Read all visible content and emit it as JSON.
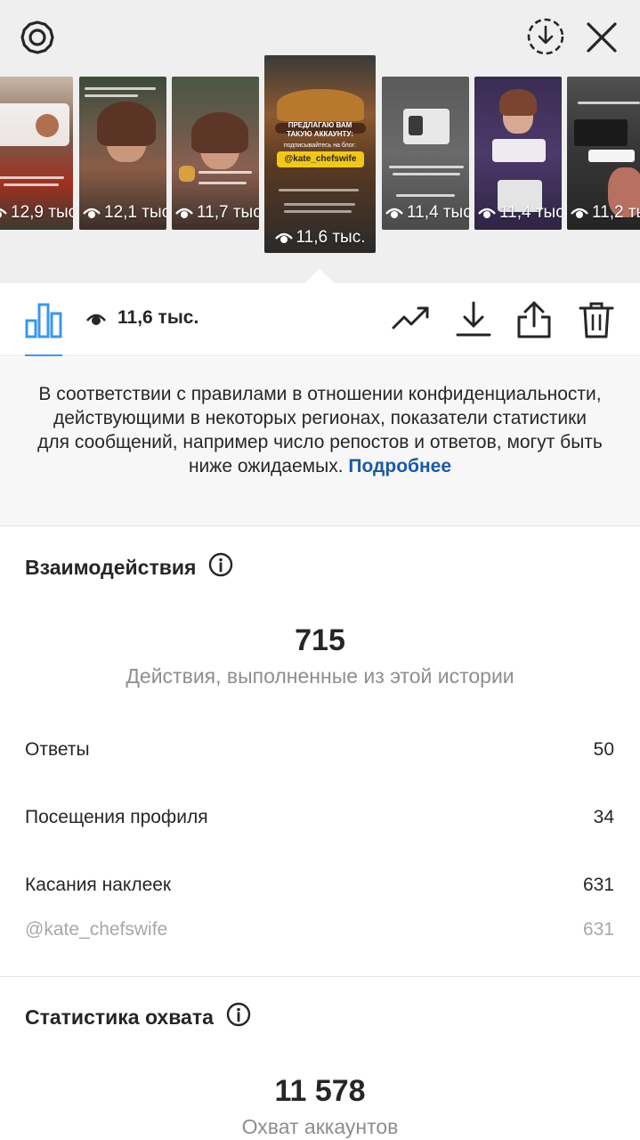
{
  "top": {
    "thumbnails": [
      {
        "views": "12,9 тыс"
      },
      {
        "views": "12,1 тыс"
      },
      {
        "views": "11,7 тыс"
      },
      {
        "views": "11,6 тыс."
      },
      {
        "views": "11,4 тыс"
      },
      {
        "views": "11,4 тыс"
      },
      {
        "views": "11,2 тыс"
      }
    ],
    "selected_story": {
      "headline": "ПРЕДЛАГАЮ ВАМ ТАКУЮ АККАУНТУ:",
      "subscribe_text": "подписывайтесь на блог:",
      "handle": "@kate_chefswife"
    }
  },
  "toolbar": {
    "views": "11,6 тыс."
  },
  "notice": {
    "text": "В соответствии с правилами в отношении конфиденциальности, действующими в некоторых регионах, показатели статистики для сообщений, например число репостов и ответов, могут быть ниже ожидаемых.",
    "link": "Подробнее"
  },
  "interactions": {
    "title": "Взаимодействия",
    "total": "715",
    "total_caption": "Действия, выполненные из этой истории",
    "rows": [
      {
        "label": "Ответы",
        "value": "50"
      },
      {
        "label": "Посещения профиля",
        "value": "34"
      },
      {
        "label": "Касания наклеек",
        "value": "631"
      },
      {
        "label": "@kate_chefswife",
        "value": "631"
      }
    ]
  },
  "reach": {
    "title": "Статистика охвата",
    "total": "11 578",
    "total_caption": "Охват аккаунтов"
  },
  "colors": {
    "accent": "#3897f0",
    "link": "#1a5aa6",
    "muted": "#8e8e8e"
  }
}
